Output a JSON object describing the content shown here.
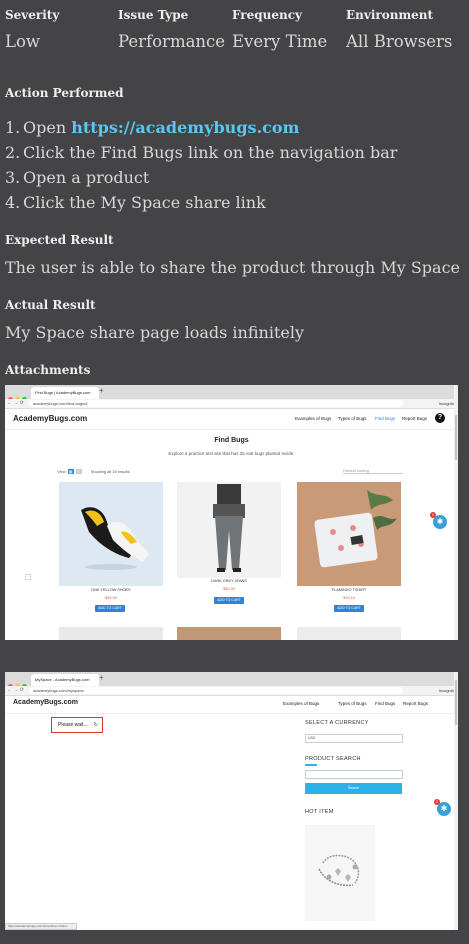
{
  "meta": [
    {
      "heading": "Severity",
      "value": "Low"
    },
    {
      "heading": "Issue Type",
      "value": "Performance"
    },
    {
      "heading": "Frequency",
      "value": "Every Time"
    },
    {
      "heading": "Environment",
      "value": "All Browsers"
    }
  ],
  "action": {
    "heading": "Action Performed",
    "steps": [
      {
        "num": "1.",
        "text": "Open ",
        "link": "https://academybugs.com"
      },
      {
        "num": "2.",
        "text": "Click the Find Bugs link on the navigation bar"
      },
      {
        "num": "3.",
        "text": "Open a product"
      },
      {
        "num": "4.",
        "text": "Click the My Space share link"
      }
    ]
  },
  "expected": {
    "heading": "Expected Result",
    "text": "The user is able to share the product through My Space"
  },
  "actual": {
    "heading": "Actual Result",
    "text": "My Space share page loads infinitely"
  },
  "attachments": {
    "heading": "Attachments",
    "shot1": {
      "tab_title": "Find Bugs | AcademyBugs.com",
      "url": "academybugs.com/find-bugs/#",
      "incognito": "Incognito",
      "logo": "AcademyBugs.com",
      "menu": [
        "Examples of Bugs",
        "Types of Bugs",
        "Find Bugs",
        "Report Bugs"
      ],
      "help": "?",
      "title": "Find Bugs",
      "subtitle": "Explore a practice test site that has 25 real bugs planted inside.",
      "view_label": "View",
      "showing": "Showing all 18 results",
      "sort": "Default sorting",
      "products": [
        {
          "name": "DNK YELLOW SHOES",
          "price": "$45.00",
          "button": "ADD TO CART"
        },
        {
          "name": "DARK GREY JEANS",
          "price": "$40.00",
          "button": "ADD TO CART"
        },
        {
          "name": "FLAMINGO TSHIRT",
          "price": "$15.16",
          "button": "ADD TO CART"
        }
      ],
      "badge_count": "0"
    },
    "shot2": {
      "tab_title": "MySpace - AcademyBugs.com",
      "url": "academybugs.com/myspace",
      "incognito": "Incognito",
      "logo": "AcademyBugs.com",
      "menu": [
        "Examples of Bugs",
        "Types of Bugs",
        "Find Bugs",
        "Report Bugs"
      ],
      "wait_text": "Please wait...",
      "currency_heading": "SELECT A CURRENCY",
      "currency_value": "USD",
      "search_heading": "PRODUCT SEARCH",
      "search_button": "Search",
      "hot_heading": "HOT ITEM",
      "status_text": "https://academybugs.com/store/silver-charm-bracelet/",
      "badge_count": "0"
    }
  }
}
